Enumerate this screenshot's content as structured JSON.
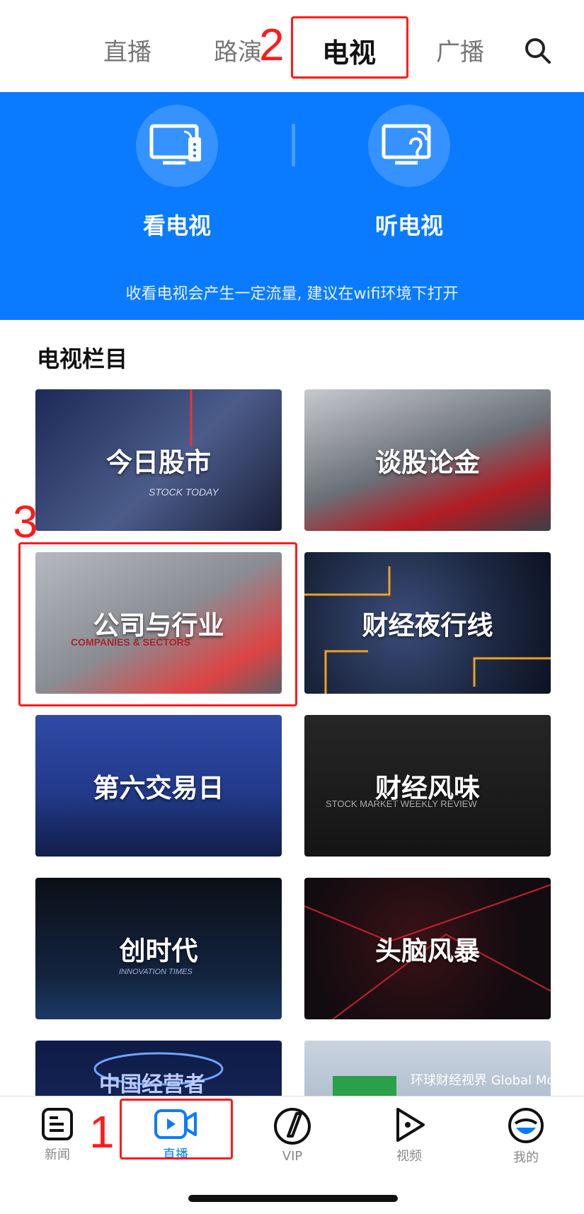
{
  "topnav": {
    "tabs": [
      {
        "label": "直播"
      },
      {
        "label": "路演"
      },
      {
        "label": "电视"
      },
      {
        "label": "广播"
      }
    ],
    "active": "电视",
    "search_icon": "search-icon"
  },
  "banner": {
    "watch_tv": "看电视",
    "listen_tv": "听电视",
    "note": "收看电视会产生一定流量, 建议在wifi环境下打开"
  },
  "section": {
    "title": "电视栏目",
    "programs": [
      {
        "title": "今日股市",
        "art_text": "STOCK TODAY",
        "color": "#3a4c78"
      },
      {
        "title": "谈股论金",
        "art_text": "",
        "color": "#6b6f77"
      },
      {
        "title": "公司与行业",
        "art_text": "COMPANIES & SECTORS",
        "color": "#8a8c93"
      },
      {
        "title": "财经夜行线",
        "art_text": "",
        "color": "#1c2740"
      },
      {
        "title": "第六交易日",
        "art_text": "",
        "color": "#223a8a"
      },
      {
        "title": "财经风味",
        "art_text": "STOCK MARKET WEEKLY REVIEW",
        "color": "#1a1a1a"
      },
      {
        "title": "创时代",
        "art_text": "INNOVATION TIMES",
        "color": "#0f1a2c"
      },
      {
        "title": "头脑风暴",
        "art_text": "",
        "color": "#120b10"
      },
      {
        "title": "",
        "art_text": "中国经营者",
        "color": "#1a2f6a"
      },
      {
        "title": "",
        "art_text": "环球财经视界 Global Money",
        "color": "#8fa2b8"
      }
    ]
  },
  "tabbar": {
    "items": [
      {
        "label": "新闻",
        "icon": "news-icon"
      },
      {
        "label": "直播",
        "icon": "live-camera-icon"
      },
      {
        "label": "VIP",
        "icon": "vip-icon"
      },
      {
        "label": "视频",
        "icon": "video-play-icon"
      },
      {
        "label": "我的",
        "icon": "profile-icon"
      }
    ],
    "active": "直播"
  },
  "annotations": {
    "one": "1",
    "two": "2",
    "three": "3"
  },
  "colors": {
    "accent": "#0a7bff",
    "annotation": "#ff1a1a"
  }
}
